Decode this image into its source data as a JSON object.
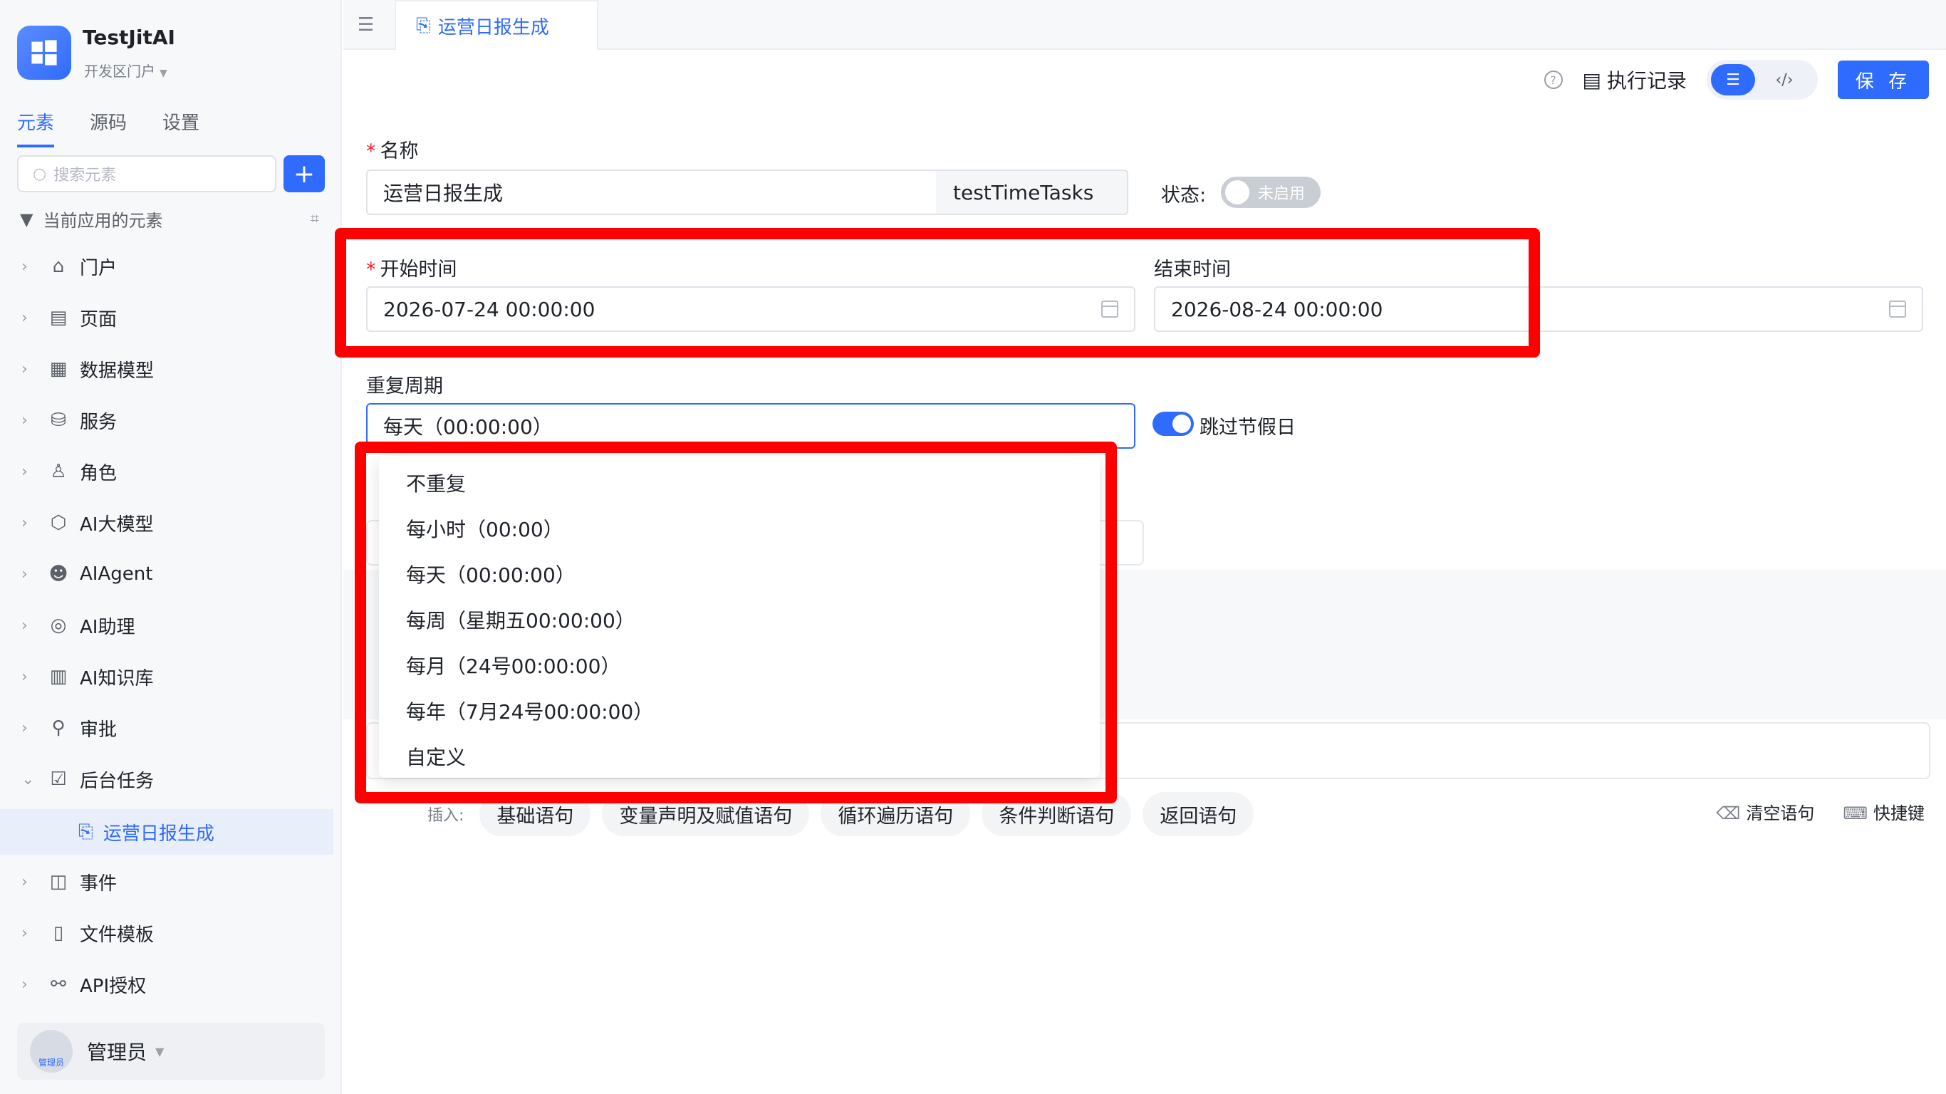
{
  "app": {
    "name": "TestJitAI",
    "portal": "开发区门户"
  },
  "sidebar": {
    "tabs": [
      "元素",
      "源码",
      "设置"
    ],
    "search_placeholder": "搜索元素",
    "add_label": "+",
    "tree_title": "当前应用的元素",
    "items": [
      {
        "label": "门户",
        "icon": "home-icon"
      },
      {
        "label": "页面",
        "icon": "page-icon"
      },
      {
        "label": "数据模型",
        "icon": "table-icon"
      },
      {
        "label": "服务",
        "icon": "service-icon"
      },
      {
        "label": "角色",
        "icon": "role-icon"
      },
      {
        "label": "AI大模型",
        "icon": "cube-icon"
      },
      {
        "label": "AIAgent",
        "icon": "robot-icon"
      },
      {
        "label": "AI助理",
        "icon": "assistant-icon"
      },
      {
        "label": "AI知识库",
        "icon": "book-icon"
      },
      {
        "label": "审批",
        "icon": "stamp-icon"
      },
      {
        "label": "后台任务",
        "icon": "task-icon"
      },
      {
        "label": "事件",
        "icon": "event-icon"
      },
      {
        "label": "文件模板",
        "icon": "file-icon"
      },
      {
        "label": "API授权",
        "icon": "link-icon"
      }
    ],
    "selected_sub": "运营日报生成",
    "user": {
      "name": "管理员",
      "avatar_text": "管理员"
    }
  },
  "topbar": {
    "tab_label": "运营日报生成"
  },
  "toolbar": {
    "exec_log": "执行记录",
    "save": "保 存"
  },
  "form": {
    "name_label": "名称",
    "name_value": "运营日报生成",
    "name_code": "testTimeTasks",
    "status_label": "状态:",
    "status_value": "未启用",
    "start_label": "开始时间",
    "start_value": "2026-07-24 00:00:00",
    "end_label": "结束时间",
    "end_value": "2026-08-24 00:00:00",
    "repeat_label": "重复周期",
    "repeat_value": "每天（00:00:00）",
    "skip_holiday": "跳过节假日"
  },
  "dropdown": {
    "options": [
      "不重复",
      "每小时（00:00）",
      "每天（00:00:00）",
      "每周（星期五00:00:00）",
      "每月（24号00:00:00）",
      "每年（7月24号00:00:00）",
      "自定义"
    ]
  },
  "insert": {
    "label": "插入:",
    "chips": [
      "基础语句",
      "变量声明及赋值语句",
      "循环遍历语句",
      "条件判断语句",
      "返回语句"
    ],
    "clear": "清空语句",
    "shortcut": "快捷键"
  },
  "colors": {
    "accent": "#2f6bff",
    "highlight": "#ff0000"
  }
}
